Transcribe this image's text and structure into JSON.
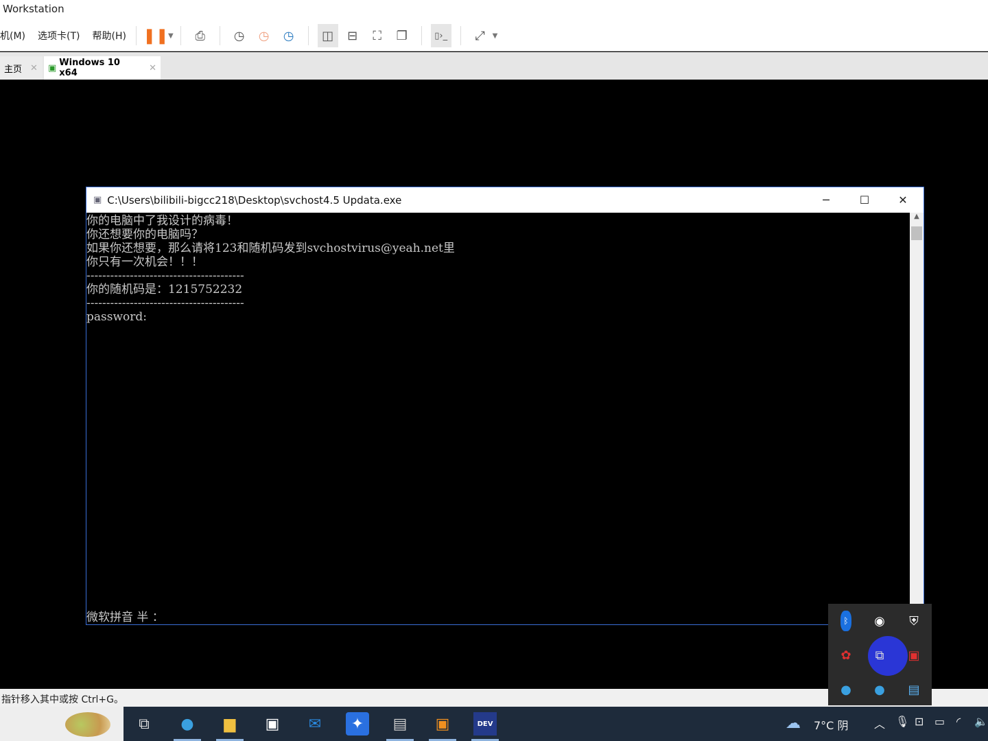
{
  "app": {
    "title": "Workstation"
  },
  "menu": [
    "机(M)",
    "选项卡(T)",
    "帮助(H)"
  ],
  "tabs": [
    {
      "label": "主页"
    },
    {
      "label": "Windows 10 x64"
    }
  ],
  "console": {
    "title": "C:\\Users\\bilibili-bigcc218\\Desktop\\svchost4.5 Updata.exe",
    "lines": [
      "你的电脑中了我设计的病毒！",
      "你还想要你的电脑吗？",
      "如果你还想要，那么请将123和随机码发到svchostvirus@yeah.net里",
      "你只有一次机会！！！",
      "----------------------------------------",
      "你的随机码是：1215752232",
      "----------------------------------------",
      "password:"
    ],
    "ime": "微软拼音 半 ："
  },
  "status": "指针移入其中或按 Ctrl+G。",
  "taskbar": {
    "weather": "7°C 阴"
  },
  "colors": {
    "pause": "#f07020",
    "taskbar": "#1e2b3b",
    "tray_highlight": "#2a36d6"
  }
}
